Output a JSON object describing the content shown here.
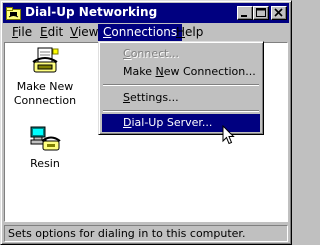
{
  "window": {
    "title": "Dial-Up Networking",
    "icon": "dialup-networking-icon",
    "controls": [
      "minimize-icon",
      "maximize-icon",
      "close-icon"
    ]
  },
  "menubar": {
    "file": "File",
    "edit": "Edit",
    "view": "View",
    "connections": "Connections",
    "help": "Help",
    "active": "Connections"
  },
  "dropdown": {
    "connect": "Connect...",
    "make_new": "Make New Connection...",
    "settings": "Settings...",
    "dialup_server": "Dial-Up Server...",
    "disabled": [
      "Connect..."
    ],
    "selected": "Dial-Up Server..."
  },
  "items": [
    {
      "label": "Make New Connection",
      "icon": "make-new-connection-icon"
    },
    {
      "label": "Resin",
      "icon": "connection-phone-computer-icon"
    }
  ],
  "status": "Sets options for dialing in to this computer.",
  "colors": {
    "titlebar": "#000080",
    "face": "#c0c0c0",
    "selection": "#000080"
  }
}
